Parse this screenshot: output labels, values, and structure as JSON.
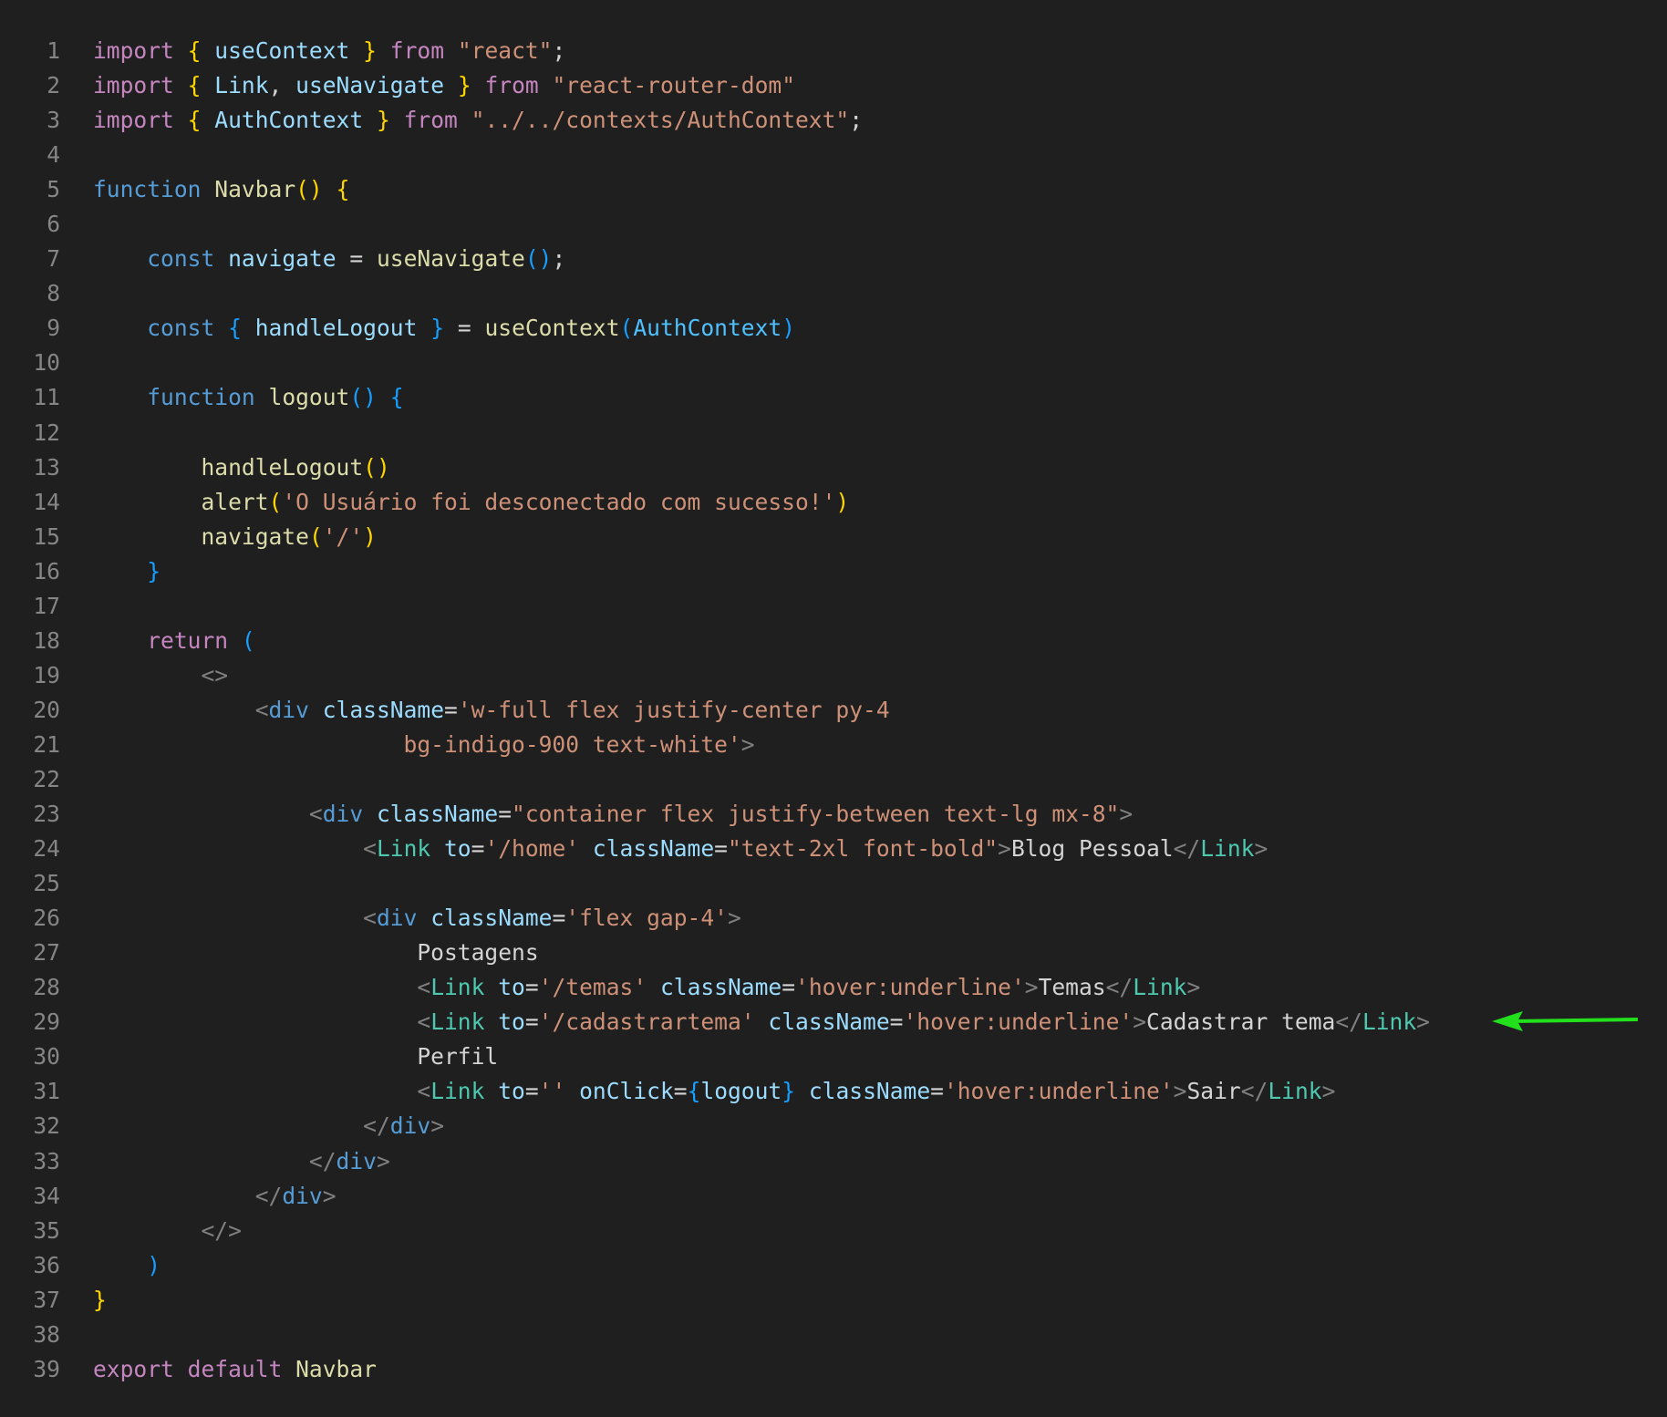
{
  "editor": {
    "line_numbers": [
      "1",
      "2",
      "3",
      "4",
      "5",
      "6",
      "7",
      "8",
      "9",
      "10",
      "11",
      "12",
      "13",
      "14",
      "15",
      "16",
      "17",
      "18",
      "19",
      "20",
      "21",
      "22",
      "23",
      "24",
      "25",
      "26",
      "27",
      "28",
      "29",
      "30",
      "31",
      "32",
      "33",
      "34",
      "35",
      "36",
      "37",
      "38",
      "39"
    ],
    "lines": [
      [
        [
          "kc",
          "import"
        ],
        [
          "tx",
          " "
        ],
        [
          "bk",
          "{"
        ],
        [
          "tx",
          " "
        ],
        [
          "vr",
          "useContext"
        ],
        [
          "tx",
          " "
        ],
        [
          "bk",
          "}"
        ],
        [
          "tx",
          " "
        ],
        [
          "kc",
          "from"
        ],
        [
          "tx",
          " "
        ],
        [
          "st",
          "\"react\""
        ],
        [
          "tx",
          ";"
        ]
      ],
      [
        [
          "kc",
          "import"
        ],
        [
          "tx",
          " "
        ],
        [
          "bk",
          "{"
        ],
        [
          "tx",
          " "
        ],
        [
          "vr",
          "Link"
        ],
        [
          "tx",
          ", "
        ],
        [
          "vr",
          "useNavigate"
        ],
        [
          "tx",
          " "
        ],
        [
          "bk",
          "}"
        ],
        [
          "tx",
          " "
        ],
        [
          "kc",
          "from"
        ],
        [
          "tx",
          " "
        ],
        [
          "st",
          "\"react-router-dom\""
        ]
      ],
      [
        [
          "kc",
          "import"
        ],
        [
          "tx",
          " "
        ],
        [
          "bk",
          "{"
        ],
        [
          "tx",
          " "
        ],
        [
          "vr",
          "AuthContext"
        ],
        [
          "tx",
          " "
        ],
        [
          "bk",
          "}"
        ],
        [
          "tx",
          " "
        ],
        [
          "kc",
          "from"
        ],
        [
          "tx",
          " "
        ],
        [
          "st",
          "\"../../contexts/AuthContext\""
        ],
        [
          "tx",
          ";"
        ]
      ],
      [],
      [
        [
          "kw",
          "function"
        ],
        [
          "tx",
          " "
        ],
        [
          "fn",
          "Navbar"
        ],
        [
          "bk",
          "()"
        ],
        [
          "tx",
          " "
        ],
        [
          "bk",
          "{"
        ]
      ],
      [],
      [
        [
          "tx",
          "    "
        ],
        [
          "kw",
          "const"
        ],
        [
          "tx",
          " "
        ],
        [
          "vr",
          "navigate"
        ],
        [
          "tx",
          " = "
        ],
        [
          "fn",
          "useNavigate"
        ],
        [
          "bl",
          "()"
        ],
        [
          "tx",
          ";"
        ]
      ],
      [],
      [
        [
          "tx",
          "    "
        ],
        [
          "kw",
          "const"
        ],
        [
          "tx",
          " "
        ],
        [
          "bl",
          "{"
        ],
        [
          "tx",
          " "
        ],
        [
          "vr",
          "handleLogout"
        ],
        [
          "tx",
          " "
        ],
        [
          "bl",
          "}"
        ],
        [
          "tx",
          " = "
        ],
        [
          "fn",
          "useContext"
        ],
        [
          "bl",
          "("
        ],
        [
          "ty",
          "AuthContext"
        ],
        [
          "bl",
          ")"
        ]
      ],
      [],
      [
        [
          "tx",
          "    "
        ],
        [
          "kw",
          "function"
        ],
        [
          "tx",
          " "
        ],
        [
          "fn",
          "logout"
        ],
        [
          "bl",
          "()"
        ],
        [
          "tx",
          " "
        ],
        [
          "bl",
          "{"
        ]
      ],
      [],
      [
        [
          "tx",
          "        "
        ],
        [
          "fn",
          "handleLogout"
        ],
        [
          "bk",
          "()"
        ]
      ],
      [
        [
          "tx",
          "        "
        ],
        [
          "fn",
          "alert"
        ],
        [
          "bk",
          "("
        ],
        [
          "st",
          "'O Usuário foi desconectado com sucesso!'"
        ],
        [
          "bk",
          ")"
        ]
      ],
      [
        [
          "tx",
          "        "
        ],
        [
          "fn",
          "navigate"
        ],
        [
          "bk",
          "("
        ],
        [
          "st",
          "'/'"
        ],
        [
          "bk",
          ")"
        ]
      ],
      [
        [
          "tx",
          "    "
        ],
        [
          "bl",
          "}"
        ]
      ],
      [],
      [
        [
          "tx",
          "    "
        ],
        [
          "kc",
          "return"
        ],
        [
          "tx",
          " "
        ],
        [
          "bl",
          "("
        ]
      ],
      [
        [
          "tx",
          "        "
        ],
        [
          "pu",
          "<>"
        ]
      ],
      [
        [
          "tx",
          "            "
        ],
        [
          "pu",
          "<"
        ],
        [
          "tg",
          "div"
        ],
        [
          "tx",
          " "
        ],
        [
          "vr",
          "className"
        ],
        [
          "tx",
          "="
        ],
        [
          "st",
          "'w-full flex justify-center py-4"
        ]
      ],
      [
        [
          "st",
          "                       bg-indigo-900 text-white'"
        ],
        [
          "pu",
          ">"
        ]
      ],
      [],
      [
        [
          "tx",
          "                "
        ],
        [
          "pu",
          "<"
        ],
        [
          "tg",
          "div"
        ],
        [
          "tx",
          " "
        ],
        [
          "vr",
          "className"
        ],
        [
          "tx",
          "="
        ],
        [
          "st",
          "\"container flex justify-between text-lg mx-8\""
        ],
        [
          "pu",
          ">"
        ]
      ],
      [
        [
          "tx",
          "                    "
        ],
        [
          "pu",
          "<"
        ],
        [
          "cp",
          "Link"
        ],
        [
          "tx",
          " "
        ],
        [
          "vr",
          "to"
        ],
        [
          "tx",
          "="
        ],
        [
          "st",
          "'/home'"
        ],
        [
          "tx",
          " "
        ],
        [
          "vr",
          "className"
        ],
        [
          "tx",
          "="
        ],
        [
          "st",
          "\"text-2xl font-bold\""
        ],
        [
          "pu",
          ">"
        ],
        [
          "tx",
          "Blog Pessoal"
        ],
        [
          "pu",
          "</"
        ],
        [
          "cp",
          "Link"
        ],
        [
          "pu",
          ">"
        ]
      ],
      [],
      [
        [
          "tx",
          "                    "
        ],
        [
          "pu",
          "<"
        ],
        [
          "tg",
          "div"
        ],
        [
          "tx",
          " "
        ],
        [
          "vr",
          "className"
        ],
        [
          "tx",
          "="
        ],
        [
          "st",
          "'flex gap-4'"
        ],
        [
          "pu",
          ">"
        ]
      ],
      [
        [
          "tx",
          "                        Postagens"
        ]
      ],
      [
        [
          "tx",
          "                        "
        ],
        [
          "pu",
          "<"
        ],
        [
          "cp",
          "Link"
        ],
        [
          "tx",
          " "
        ],
        [
          "vr",
          "to"
        ],
        [
          "tx",
          "="
        ],
        [
          "st",
          "'/temas'"
        ],
        [
          "tx",
          " "
        ],
        [
          "vr",
          "className"
        ],
        [
          "tx",
          "="
        ],
        [
          "st",
          "'hover:underline'"
        ],
        [
          "pu",
          ">"
        ],
        [
          "tx",
          "Temas"
        ],
        [
          "pu",
          "</"
        ],
        [
          "cp",
          "Link"
        ],
        [
          "pu",
          ">"
        ]
      ],
      [
        [
          "tx",
          "                        "
        ],
        [
          "pu",
          "<"
        ],
        [
          "cp",
          "Link"
        ],
        [
          "tx",
          " "
        ],
        [
          "vr",
          "to"
        ],
        [
          "tx",
          "="
        ],
        [
          "st",
          "'/cadastrartema'"
        ],
        [
          "tx",
          " "
        ],
        [
          "vr",
          "className"
        ],
        [
          "tx",
          "="
        ],
        [
          "st",
          "'hover:underline'"
        ],
        [
          "pu",
          ">"
        ],
        [
          "tx",
          "Cadastrar tema"
        ],
        [
          "pu",
          "</"
        ],
        [
          "cp",
          "Link"
        ],
        [
          "pu",
          ">"
        ]
      ],
      [
        [
          "tx",
          "                        Perfil"
        ]
      ],
      [
        [
          "tx",
          "                        "
        ],
        [
          "pu",
          "<"
        ],
        [
          "cp",
          "Link"
        ],
        [
          "tx",
          " "
        ],
        [
          "vr",
          "to"
        ],
        [
          "tx",
          "="
        ],
        [
          "st",
          "''"
        ],
        [
          "tx",
          " "
        ],
        [
          "vr",
          "onClick"
        ],
        [
          "tx",
          "="
        ],
        [
          "bl",
          "{"
        ],
        [
          "vr",
          "logout"
        ],
        [
          "bl",
          "}"
        ],
        [
          "tx",
          " "
        ],
        [
          "vr",
          "className"
        ],
        [
          "tx",
          "="
        ],
        [
          "st",
          "'hover:underline'"
        ],
        [
          "pu",
          ">"
        ],
        [
          "tx",
          "Sair"
        ],
        [
          "pu",
          "</"
        ],
        [
          "cp",
          "Link"
        ],
        [
          "pu",
          ">"
        ]
      ],
      [
        [
          "tx",
          "                    "
        ],
        [
          "pu",
          "</"
        ],
        [
          "tg",
          "div"
        ],
        [
          "pu",
          ">"
        ]
      ],
      [
        [
          "tx",
          "                "
        ],
        [
          "pu",
          "</"
        ],
        [
          "tg",
          "div"
        ],
        [
          "pu",
          ">"
        ]
      ],
      [
        [
          "tx",
          "            "
        ],
        [
          "pu",
          "</"
        ],
        [
          "tg",
          "div"
        ],
        [
          "pu",
          ">"
        ]
      ],
      [
        [
          "tx",
          "        "
        ],
        [
          "pu",
          "</>"
        ]
      ],
      [
        [
          "tx",
          "    "
        ],
        [
          "bl",
          ")"
        ]
      ],
      [
        [
          "bk",
          "}"
        ]
      ],
      [],
      [
        [
          "kc",
          "export"
        ],
        [
          "tx",
          " "
        ],
        [
          "kc",
          "default"
        ],
        [
          "tx",
          " "
        ],
        [
          "fn",
          "Navbar"
        ]
      ]
    ]
  },
  "annotation": {
    "icon": "arrow-left-icon",
    "color": "#22e01c",
    "points_to_line": 29
  }
}
